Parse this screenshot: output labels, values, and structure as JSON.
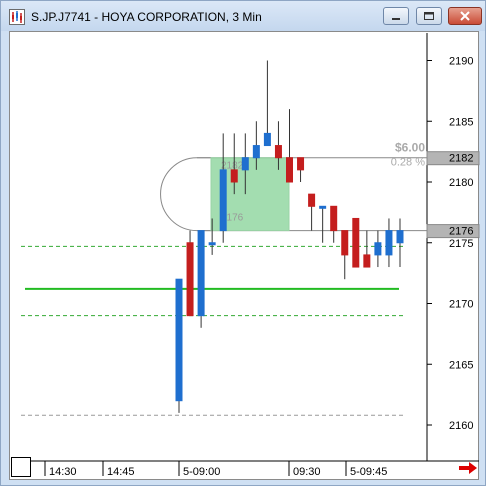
{
  "window": {
    "title": "S.JP.J7741 - HOYA CORPORATION, 3 Min",
    "buttons": [
      "minimize",
      "maximize",
      "close"
    ]
  },
  "colors": {
    "up_candle": "#1f6fcf",
    "down_candle": "#c41e1e",
    "green_line": "#22bb22",
    "green_dash": "#33aa33",
    "gray_dash": "#999999",
    "measure_fill": "#7ccf8e",
    "label_bg": "#b4b4b4",
    "scroll_arrow": "#dd0000"
  },
  "chart_data": {
    "type": "candlestick",
    "title": "S.JP.J7741 - HOYA CORPORATION, 3 Min",
    "ylim": [
      2158,
      2193
    ],
    "y_ticks": [
      2160,
      2165,
      2170,
      2175,
      2180,
      2185,
      2190
    ],
    "y_tick_labels": [
      "2160",
      "2165",
      "2170",
      "2175",
      "2180",
      "2185",
      "2190"
    ],
    "x_tick_labels": [
      "14:30",
      "14:45",
      "5-09:00",
      "09:30",
      "5-09:45"
    ],
    "candles": [
      {
        "open": 2162,
        "high": 2172,
        "low": 2161,
        "close": 2172
      },
      {
        "open": 2175,
        "high": 2176,
        "low": 2169,
        "close": 2169
      },
      {
        "open": 2169,
        "high": 2176,
        "low": 2168,
        "close": 2176
      },
      {
        "open": 2175,
        "high": 2177,
        "low": 2174,
        "close": 2175
      },
      {
        "open": 2176,
        "high": 2184,
        "low": 2175,
        "close": 2181
      },
      {
        "open": 2181,
        "high": 2184,
        "low": 2179,
        "close": 2180
      },
      {
        "open": 2181,
        "high": 2184,
        "low": 2179,
        "close": 2182
      },
      {
        "open": 2182,
        "high": 2185,
        "low": 2181,
        "close": 2183
      },
      {
        "open": 2183,
        "high": 2190,
        "low": 2183,
        "close": 2184
      },
      {
        "open": 2183,
        "high": 2185,
        "low": 2181,
        "close": 2182
      },
      {
        "open": 2182,
        "high": 2186,
        "low": 2180,
        "close": 2180
      },
      {
        "open": 2182,
        "high": 2182,
        "low": 2180,
        "close": 2181
      },
      {
        "open": 2179,
        "high": 2179,
        "low": 2176,
        "close": 2178
      },
      {
        "open": 2178,
        "high": 2178,
        "low": 2175,
        "close": 2178
      },
      {
        "open": 2178,
        "high": 2178,
        "low": 2175,
        "close": 2176
      },
      {
        "open": 2176,
        "high": 2176,
        "low": 2172,
        "close": 2174
      },
      {
        "open": 2177,
        "high": 2177,
        "low": 2173,
        "close": 2173
      },
      {
        "open": 2174,
        "high": 2176,
        "low": 2173,
        "close": 2173
      },
      {
        "open": 2174,
        "high": 2176,
        "low": 2173,
        "close": 2175
      },
      {
        "open": 2174,
        "high": 2177,
        "low": 2173,
        "close": 2176
      },
      {
        "open": 2175,
        "high": 2177,
        "low": 2173,
        "close": 2176
      }
    ],
    "horizontal_lines": [
      {
        "price": 2171.2,
        "style": "solid",
        "color": "green"
      },
      {
        "price": 2174.7,
        "style": "dashed",
        "color": "green"
      },
      {
        "price": 2169.0,
        "style": "dashed",
        "color": "green"
      },
      {
        "price": 2160.8,
        "style": "dashed",
        "color": "gray"
      }
    ],
    "price_labels": [
      "2182",
      "2176"
    ],
    "measure": {
      "from_price": 2176,
      "to_price": 2182,
      "from_label": "2176",
      "to_label": "2182",
      "change": "$6.00",
      "percent": "0.28 %"
    }
  }
}
